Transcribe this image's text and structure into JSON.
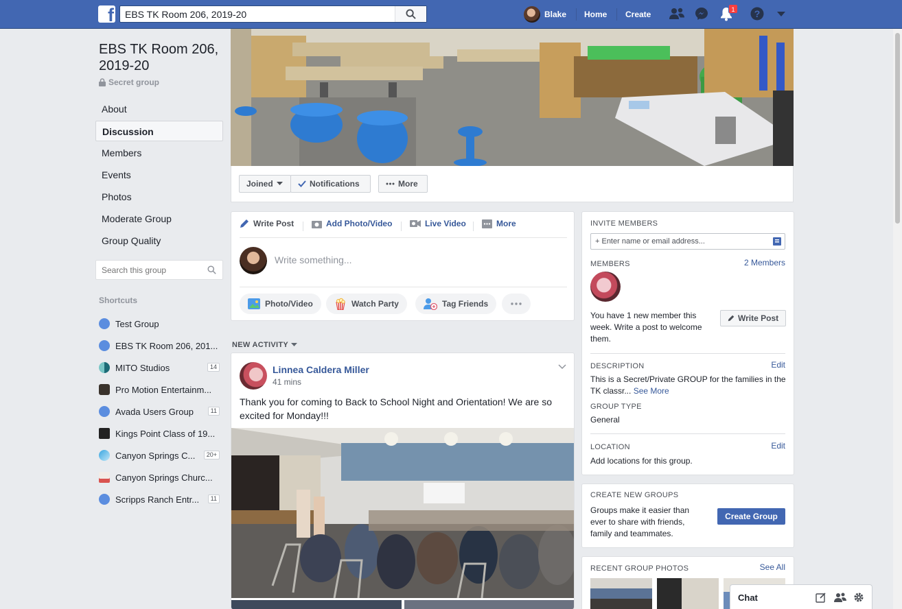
{
  "topbar": {
    "logo": "f",
    "search_value": "EBS TK Room 206, 2019-20",
    "user": "Blake",
    "home": "Home",
    "create": "Create",
    "notification_count": "1"
  },
  "group": {
    "title": "EBS TK Room 206, 2019-20",
    "privacy": "Secret group"
  },
  "leftnav": [
    "About",
    "Discussion",
    "Members",
    "Events",
    "Photos",
    "Moderate Group",
    "Group Quality"
  ],
  "group_search_placeholder": "Search this group",
  "shortcuts": {
    "heading": "Shortcuts",
    "items": [
      {
        "label": "Test Group",
        "count": ""
      },
      {
        "label": "EBS TK Room 206, 201...",
        "count": ""
      },
      {
        "label": "MITO Studios",
        "count": "14"
      },
      {
        "label": "Pro Motion Entertainm...",
        "count": ""
      },
      {
        "label": "Avada Users Group",
        "count": "11"
      },
      {
        "label": "Kings Point Class of 19...",
        "count": ""
      },
      {
        "label": "Canyon Springs C...",
        "count": "20+"
      },
      {
        "label": "Canyon Springs Churc...",
        "count": ""
      },
      {
        "label": "Scripps Ranch Entr...",
        "count": "11"
      }
    ]
  },
  "cover_actions": {
    "joined": "Joined",
    "notifications": "Notifications",
    "more": "More"
  },
  "composer": {
    "tabs": [
      "Write Post",
      "Add Photo/Video",
      "Live Video",
      "More"
    ],
    "placeholder": "Write something...",
    "pills": [
      "Photo/Video",
      "Watch Party",
      "Tag Friends"
    ]
  },
  "feed": {
    "heading": "NEW ACTIVITY",
    "post": {
      "author": "Linnea Caldera Miller",
      "time": "41 mins",
      "text": "Thank you for coming to Back to School Night and Orientation! We are so excited for Monday!!!"
    }
  },
  "sidebar": {
    "invite_heading": "INVITE MEMBERS",
    "invite_placeholder": "+ Enter name or email address...",
    "members_heading": "MEMBERS",
    "members_count": "2 Members",
    "new_member_text": "You have 1 new member this week. Write a post to welcome them.",
    "write_post": "Write Post",
    "description_heading": "DESCRIPTION",
    "edit": "Edit",
    "description_text": "This is a Secret/Private GROUP for the families in the TK classr...",
    "see_more": "See More",
    "group_type_heading": "GROUP TYPE",
    "group_type": "General",
    "location_heading": "LOCATION",
    "location_text": "Add locations for this group.",
    "create_heading": "CREATE NEW GROUPS",
    "create_text": "Groups make it easier than ever to share with friends, family and teammates.",
    "create_button": "Create Group",
    "recent_photos_heading": "RECENT GROUP PHOTOS",
    "see_all": "See All"
  },
  "chat": {
    "label": "Chat"
  },
  "colors": {
    "brand": "#4267b2",
    "link": "#365899",
    "background": "#e9ebee"
  }
}
